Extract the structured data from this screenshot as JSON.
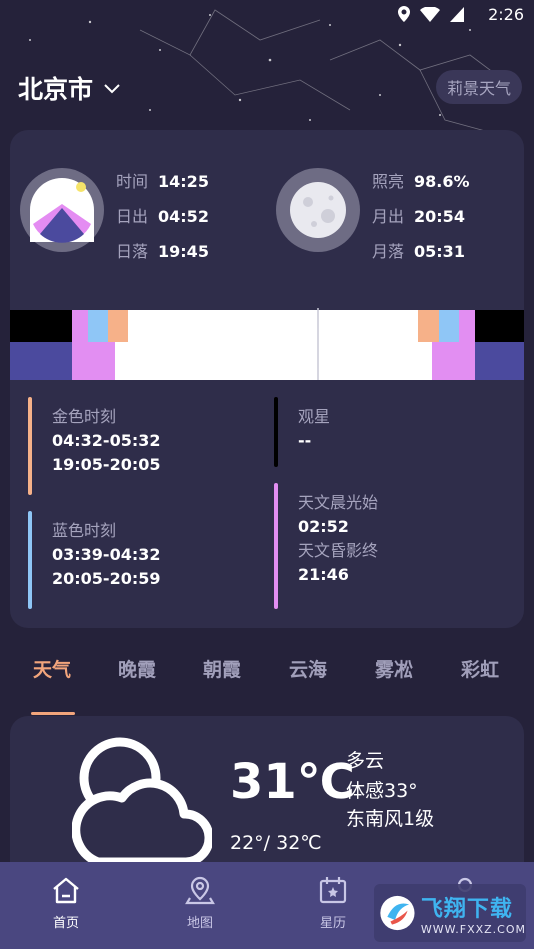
{
  "status_bar": {
    "time": "2:26"
  },
  "header": {
    "city": "北京市",
    "brand": "莉景天气"
  },
  "sun": {
    "time_label": "时间",
    "time": "14:25",
    "sunrise_label": "日出",
    "sunrise": "04:52",
    "sunset_label": "日落",
    "sunset": "19:45"
  },
  "moon": {
    "illum_label": "照亮",
    "illum": "98.6%",
    "moonrise_label": "月出",
    "moonrise": "20:54",
    "moonset_label": "月落",
    "moonset": "05:31"
  },
  "periods": {
    "golden": {
      "title": "金色时刻",
      "am": "04:32-05:32",
      "pm": "19:05-20:05",
      "color": "#f6b189"
    },
    "stargazing": {
      "title": "观星",
      "value": "--",
      "color": "#000000"
    },
    "blue": {
      "title": "蓝色时刻",
      "am": "03:39-04:32",
      "pm": "20:05-20:59",
      "color": "#8fc6f6"
    },
    "astro": {
      "dawn_label": "天文晨光始",
      "dawn": "02:52",
      "dusk_label": "天文昏影终",
      "dusk": "21:46",
      "color": "#e28ef2"
    }
  },
  "tabs": [
    "天气",
    "晚霞",
    "朝霞",
    "云海",
    "雾凇",
    "彩虹"
  ],
  "weather": {
    "temp": "31℃",
    "condition": "多云",
    "feels_like": "体感33°",
    "wind": "东南风1级",
    "range": "22°/ 32℃"
  },
  "bottom_nav": {
    "home": "首页",
    "map": "地图",
    "calendar": "星历"
  },
  "watermark": {
    "main": "飞翔下载",
    "sub": "WWW.FXXZ.COM"
  },
  "colors": {
    "background": "#25223a",
    "card": "#2f2d4a",
    "accent": "#f2a57c",
    "nav": "#4a4780"
  }
}
